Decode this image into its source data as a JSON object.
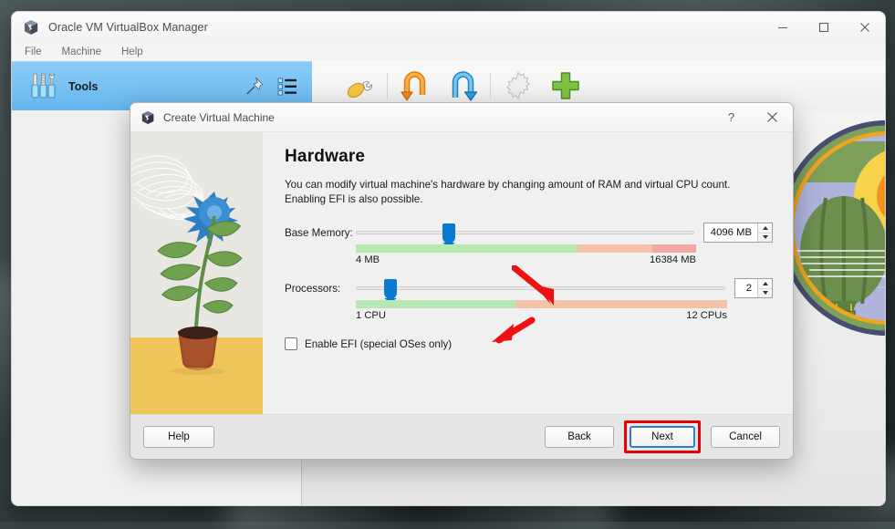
{
  "app_window": {
    "title": "Oracle VM VirtualBox Manager",
    "logo_icon": "virtualbox-logo-icon",
    "controls": {
      "minimize": "—",
      "maximize": "□",
      "close": "✕"
    },
    "menubar": [
      "File",
      "Machine",
      "Help"
    ],
    "tools_chip": {
      "label": "Tools",
      "icon": "tools-icon",
      "pin_icon": "pin-icon",
      "list_icon": "list-view-icon"
    },
    "toolbar_icons": [
      "preferences-icon",
      "import-appliance-icon",
      "export-appliance-icon",
      "new-star-icon",
      "add-plus-icon"
    ]
  },
  "dialog": {
    "title": "Create Virtual Machine",
    "logo_icon": "virtualbox-logo-icon",
    "help_icon": "?",
    "close_icon": "✕",
    "heading": "Hardware",
    "description": "You can modify virtual machine's hardware by changing amount of RAM and virtual CPU count.\nEnabling EFI is also possible.",
    "base_memory": {
      "label": "Base Memory:",
      "value": "4096 MB",
      "min_label": "4 MB",
      "max_label": "16384 MB",
      "handle_percent": 27.5,
      "green_percent": 65,
      "orange_percent": 22,
      "red_percent": 13
    },
    "processors": {
      "label": "Processors:",
      "value": "2",
      "min_label": "1 CPU",
      "max_label": "12 CPUs",
      "handle_percent": 9.5,
      "green_percent": 43,
      "orange_percent": 57
    },
    "efi": {
      "label": "Enable EFI (special OSes only)",
      "checked": false
    },
    "footer": {
      "help": "Help",
      "back": "Back",
      "next": "Next",
      "cancel": "Cancel"
    }
  },
  "annotations": {
    "arrow_color": "#ee1111",
    "highlight_color": "#e60000",
    "arrows": [
      "memory-slider-arrow",
      "processors-slider-arrow"
    ],
    "highlighted_control": "next-button"
  },
  "colors": {
    "accent_blue": "#0b79d0",
    "chip_blue": "#79c2f2",
    "slider_green": "#b8e8b2",
    "slider_orange": "#f2c3a6",
    "slider_red": "#f0a9a0"
  }
}
